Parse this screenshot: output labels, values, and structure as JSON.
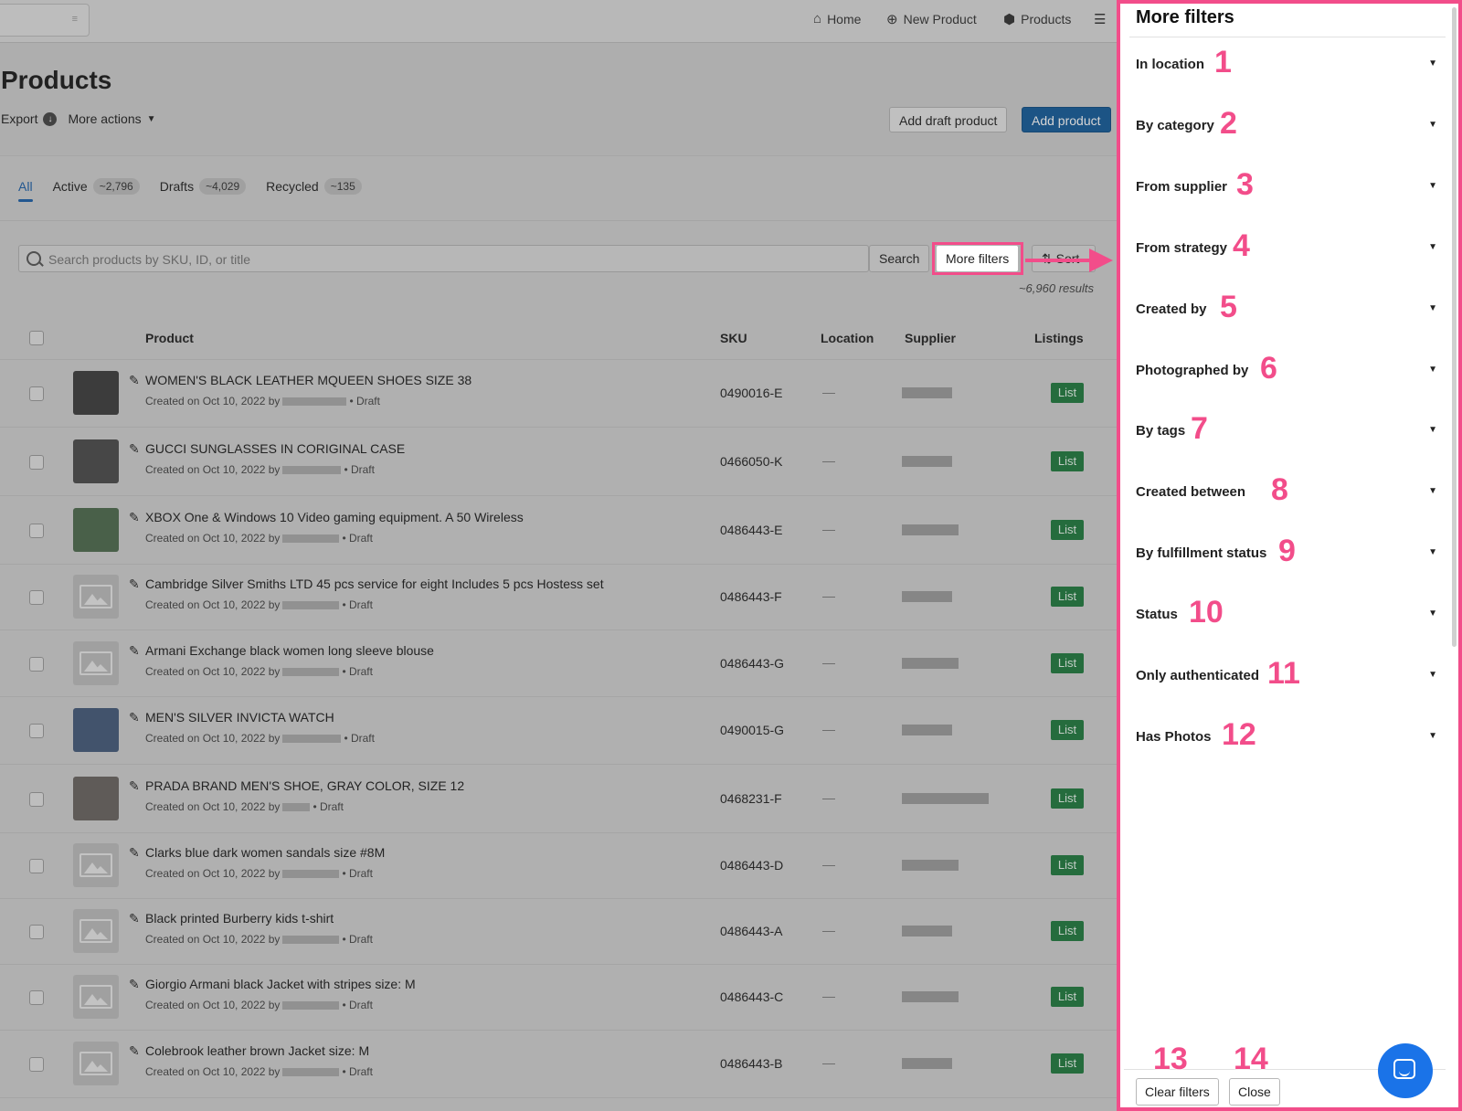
{
  "nav": {
    "home": "Home",
    "new_product": "New Product",
    "products": "Products"
  },
  "page": {
    "title": "Products",
    "export": "Export",
    "more_actions": "More actions",
    "add_draft": "Add draft product",
    "add_product": "Add product"
  },
  "tabs": [
    {
      "label": "All",
      "count": ""
    },
    {
      "label": "Active",
      "count": "~2,796"
    },
    {
      "label": "Drafts",
      "count": "~4,029"
    },
    {
      "label": "Recycled",
      "count": "~135"
    }
  ],
  "search": {
    "placeholder": "Search products by SKU, ID, or title",
    "button": "Search",
    "more_filters": "More filters",
    "sort": "Sort",
    "results": "~6,960 results"
  },
  "table": {
    "headers": {
      "product": "Product",
      "sku": "SKU",
      "location": "Location",
      "supplier": "Supplier",
      "listings": "Listings"
    },
    "rows": [
      {
        "title": "WOMEN'S BLACK LEATHER MQUEEN SHOES SIZE 38",
        "created": "Created on Oct 10, 2022 by",
        "status": "• Draft",
        "sku": "0490016-E",
        "location": "—",
        "list": "List"
      },
      {
        "title": "GUCCI SUNGLASSES IN CORIGINAL CASE",
        "created": "Created on Oct 10, 2022 by",
        "status": "• Draft",
        "sku": "0466050-K",
        "location": "—",
        "list": "List"
      },
      {
        "title": "XBOX One & Windows 10 Video gaming equipment. A 50 Wireless",
        "created": "Created on Oct 10, 2022 by",
        "status": "• Draft",
        "sku": "0486443-E",
        "location": "—",
        "list": "List"
      },
      {
        "title": "Cambridge Silver Smiths LTD 45 pcs service for eight Includes 5 pcs Hostess set",
        "created": "Created on Oct 10, 2022 by",
        "status": "• Draft",
        "sku": "0486443-F",
        "location": "—",
        "list": "List"
      },
      {
        "title": "Armani Exchange black women long sleeve blouse",
        "created": "Created on Oct 10, 2022 by",
        "status": "• Draft",
        "sku": "0486443-G",
        "location": "—",
        "list": "List"
      },
      {
        "title": "MEN'S SILVER INVICTA WATCH",
        "created": "Created on Oct 10, 2022 by",
        "status": "• Draft",
        "sku": "0490015-G",
        "location": "—",
        "list": "List"
      },
      {
        "title": "PRADA BRAND MEN'S SHOE, GRAY COLOR, SIZE 12",
        "created": "Created on Oct 10, 2022 by",
        "status": "• Draft",
        "sku": "0468231-F",
        "location": "—",
        "list": "List"
      },
      {
        "title": "Clarks blue dark women sandals size #8M",
        "created": "Created on Oct 10, 2022 by",
        "status": "• Draft",
        "sku": "0486443-D",
        "location": "—",
        "list": "List"
      },
      {
        "title": "Black printed Burberry kids t-shirt",
        "created": "Created on Oct 10, 2022 by",
        "status": "• Draft",
        "sku": "0486443-A",
        "location": "—",
        "list": "List"
      },
      {
        "title": "Giorgio Armani black Jacket with stripes size: M",
        "created": "Created on Oct 10, 2022 by",
        "status": "• Draft",
        "sku": "0486443-C",
        "location": "—",
        "list": "List"
      },
      {
        "title": "Colebrook leather brown Jacket size: M",
        "created": "Created on Oct 10, 2022 by",
        "status": "• Draft",
        "sku": "0486443-B",
        "location": "—",
        "list": "List"
      }
    ]
  },
  "panel": {
    "title": "More filters",
    "filters": [
      {
        "label": "In location",
        "num": "1"
      },
      {
        "label": "By category",
        "num": "2"
      },
      {
        "label": "From supplier",
        "num": "3"
      },
      {
        "label": "From strategy",
        "num": "4"
      },
      {
        "label": "Created by",
        "num": "5"
      },
      {
        "label": "Photographed by",
        "num": "6"
      },
      {
        "label": "By tags",
        "num": "7"
      },
      {
        "label": "Created between",
        "num": "8"
      },
      {
        "label": "By fulfillment status",
        "num": "9"
      },
      {
        "label": "Status",
        "num": "10"
      },
      {
        "label": "Only authenticated",
        "num": "11"
      },
      {
        "label": "Has Photos",
        "num": "12"
      }
    ],
    "clear": "Clear filters",
    "close": "Close",
    "clear_num": "13",
    "close_num": "14"
  },
  "colors": {
    "annotation": "#f24d8a",
    "primary": "#145b9a",
    "list_button": "#1f7a3e",
    "chat": "#1a73e8"
  }
}
